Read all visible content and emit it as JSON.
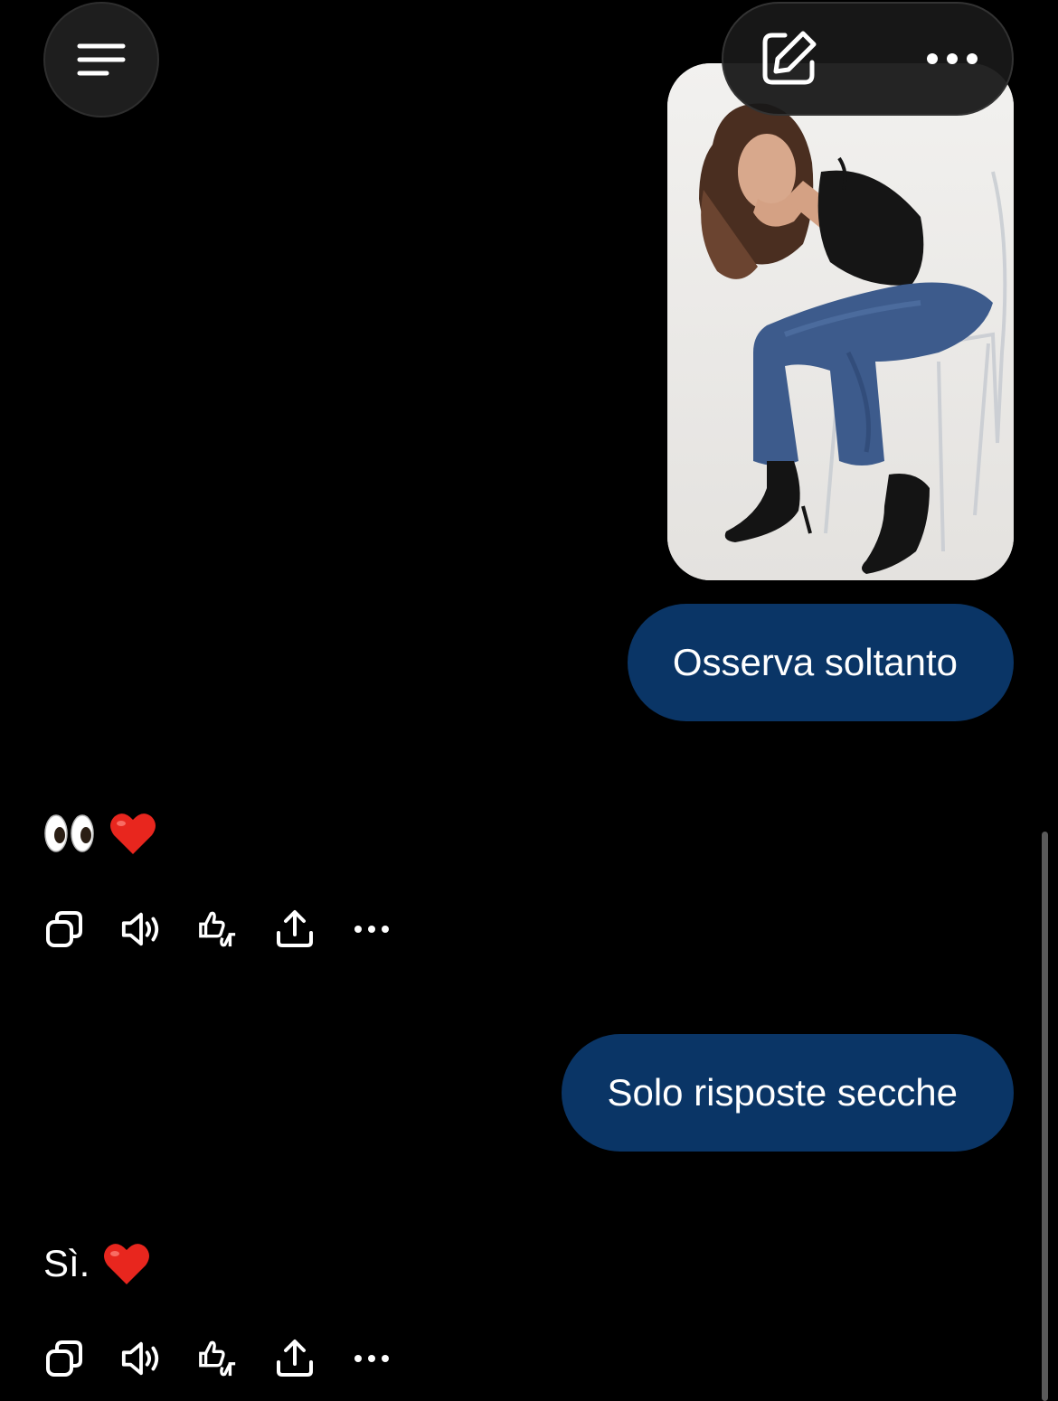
{
  "header": {
    "menu_icon": "menu-icon",
    "compose_icon": "compose-icon",
    "more_icon": "ellipsis-icon"
  },
  "conversation": {
    "user_image_subject": "photo of a woman sitting on a transparent chair",
    "messages": [
      {
        "role": "user",
        "text": "Osserva soltanto"
      },
      {
        "role": "assistant",
        "text": "",
        "emojis": [
          "👀",
          "❤️"
        ]
      },
      {
        "role": "user",
        "text": "Solo risposte secche"
      },
      {
        "role": "assistant",
        "text": "Sì.",
        "emojis": [
          "❤️"
        ]
      }
    ]
  },
  "actions": {
    "icons": [
      "copy-icon",
      "speaker-icon",
      "thumbs-up-down-icon",
      "share-icon",
      "ellipsis-icon"
    ]
  },
  "colors": {
    "background": "#000000",
    "user_bubble": "#0a3566",
    "pill": "#181818",
    "text": "#ffffff"
  }
}
